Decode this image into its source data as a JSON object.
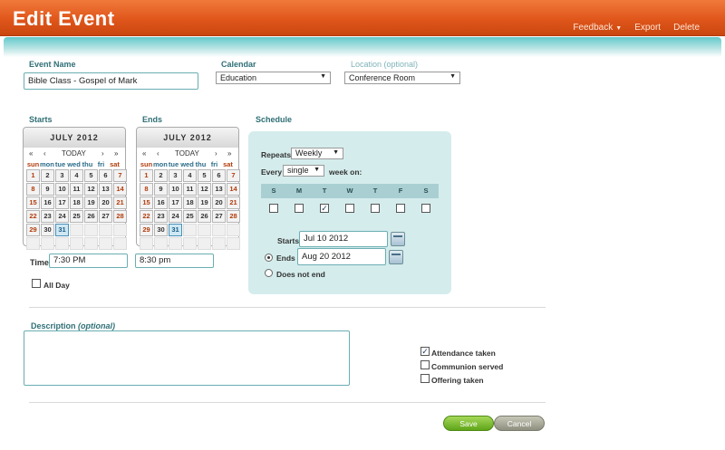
{
  "header": {
    "title": "Edit Event",
    "nav": {
      "feedback": "Feedback",
      "export": "Export",
      "delete": "Delete"
    }
  },
  "event": {
    "name_label": "Event Name",
    "name_value": "Bible Class - Gospel of Mark",
    "calendar_label": "Calendar",
    "calendar_value": "Education",
    "location_label": "Location (optional)",
    "location_value": "Conference Room"
  },
  "starts": {
    "label": "Starts",
    "month": "JULY 2012",
    "today": "TODAY",
    "time_label": "Time",
    "time_value": "7:30 PM"
  },
  "ends": {
    "label": "Ends",
    "month": "JULY 2012",
    "today": "TODAY",
    "time_value": "8:30 pm"
  },
  "calendar_nav": {
    "first": "«",
    "prev": "‹",
    "next": "›",
    "last": "»"
  },
  "weekdays": [
    "sun",
    "mon",
    "tue",
    "wed",
    "thu",
    "fri",
    "sat"
  ],
  "calendar_days": [
    [
      "1",
      "2",
      "3",
      "4",
      "5",
      "6",
      "7"
    ],
    [
      "8",
      "9",
      "10",
      "11",
      "12",
      "13",
      "14"
    ],
    [
      "15",
      "16",
      "17",
      "18",
      "19",
      "20",
      "21"
    ],
    [
      "22",
      "23",
      "24",
      "25",
      "26",
      "27",
      "28"
    ],
    [
      "29",
      "30",
      "31",
      "",
      "",
      "",
      ""
    ],
    [
      "",
      "",
      "",
      "",
      "",
      "",
      ""
    ]
  ],
  "selected_day": "31",
  "all_day_label": "All Day",
  "schedule": {
    "label": "Schedule",
    "repeats_label": "Repeats",
    "repeats_value": "Weekly",
    "every_label": "Every",
    "every_value": "single",
    "week_on_label": "week on:",
    "days": [
      "S",
      "M",
      "T",
      "W",
      "T",
      "F",
      "S"
    ],
    "days_checked": [
      false,
      false,
      true,
      false,
      false,
      false,
      false
    ],
    "starts_label": "Starts",
    "starts_value": "Jul 10 2012",
    "ends_label": "Ends",
    "ends_value": "Aug 20 2012",
    "does_not_end_label": "Does not end"
  },
  "description": {
    "label": "Description",
    "optional": "(optional)",
    "value": ""
  },
  "options": [
    {
      "label": "Attendance taken",
      "checked": true
    },
    {
      "label": "Communion served",
      "checked": false
    },
    {
      "label": "Offering taken",
      "checked": false
    }
  ],
  "buttons": {
    "save": "Save",
    "cancel": "Cancel"
  }
}
